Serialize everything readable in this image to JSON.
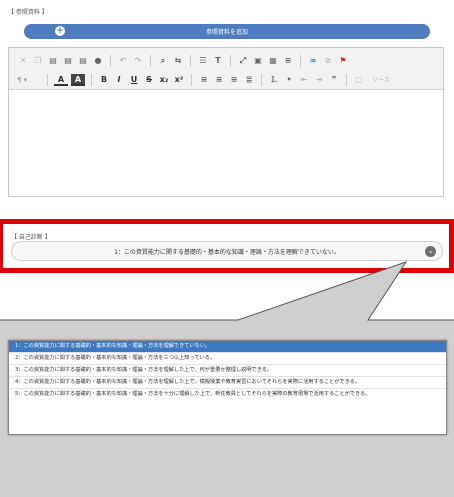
{
  "references": {
    "label": "【 参照資料 】",
    "add_button_label": "参照資料を追加"
  },
  "editor": {
    "source_label": "ソース"
  },
  "self_assessment": {
    "label": "【 自己診断 】",
    "selected_value": "1：この資質能力に関する基礎的・基本的な知識・理論・方法を理解できていない。"
  },
  "options": [
    "1：この資質能力に関する基礎的・基本的な知識・理論・方法を理解できていない。",
    "2：この資質能力に関する基礎的・基本的な知識・理論・方法を三つ以上知っている。",
    "3：この資質能力に関する基礎的・基本的な知識・理論・方法を理解した上で、何が重要か整理し説明できる。",
    "4：この資質能力に関する基礎的・基本的な知識・理論・方法を理解した上で、模擬授業や教育実習においてそれらを実際に活用することができる。",
    "5：この資質能力に関する基礎的・基本的な知識・理論・方法を十分に理解した上で、新任教員としてそれらを実際の教育現場で活用することができる。"
  ],
  "colors": {
    "accent": "#4f7cbf",
    "highlight": "#e00000",
    "selected_option": "#3c79c2"
  },
  "icons": {
    "add": "plus-circle-icon",
    "dropdown": "chevron-down-icon"
  }
}
